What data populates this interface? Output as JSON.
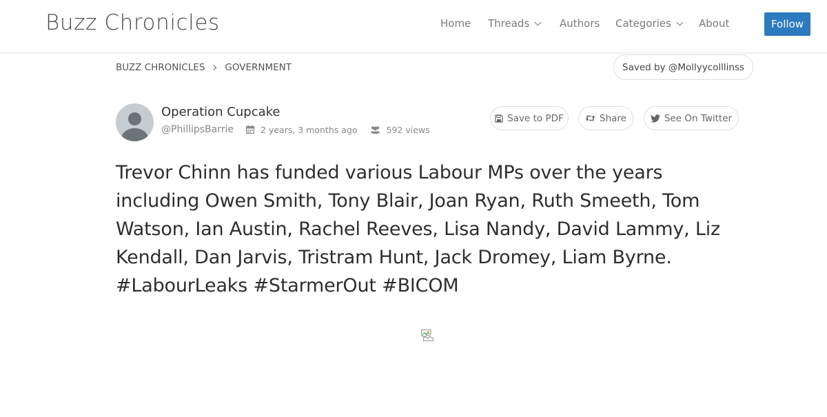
{
  "header": {
    "brand": "Buzz Chronicles",
    "nav": [
      {
        "label": "Home",
        "has_caret": false
      },
      {
        "label": "Threads",
        "has_caret": true
      },
      {
        "label": "Authors",
        "has_caret": false
      },
      {
        "label": "Categories",
        "has_caret": true
      },
      {
        "label": "About",
        "has_caret": false
      }
    ],
    "follow_label": "Follow"
  },
  "breadcrumb": {
    "root": "BUZZ CHRONICLES",
    "current": "GOVERNMENT"
  },
  "saved_by": "Saved by @Mollyycolllinss",
  "author": {
    "name": "Operation Cupcake",
    "handle": "@PhillipsBarrie",
    "posted": "2 years, 3 months ago",
    "views": "592 views"
  },
  "actions": {
    "pdf": "Save to PDF",
    "share": "Share",
    "twitter": "See On Twitter"
  },
  "tweet": {
    "text": "Trevor Chinn has funded various Labour MPs over the years including Owen Smith, Tony Blair, Joan Ryan, Ruth Smeeth, Tom Watson, Ian Austin, Rachel Reeves, Lisa Nandy, David Lammy, Liz Kendall, Dan Jarvis, Tristram Hunt, Jack Dromey, Liam Byrne. #LabourLeaks #StarmerOut #BICOM"
  },
  "colors": {
    "accent": "#2c7bbf",
    "text": "#2e2e2e",
    "muted": "#888888"
  },
  "icons": {
    "calendar": "calendar-icon",
    "views": "users-icon",
    "pdf": "save-icon",
    "share": "retweet-icon",
    "twitter": "twitter-bird-icon",
    "avatar": "default-avatar-icon",
    "image": "broken-image-icon"
  }
}
